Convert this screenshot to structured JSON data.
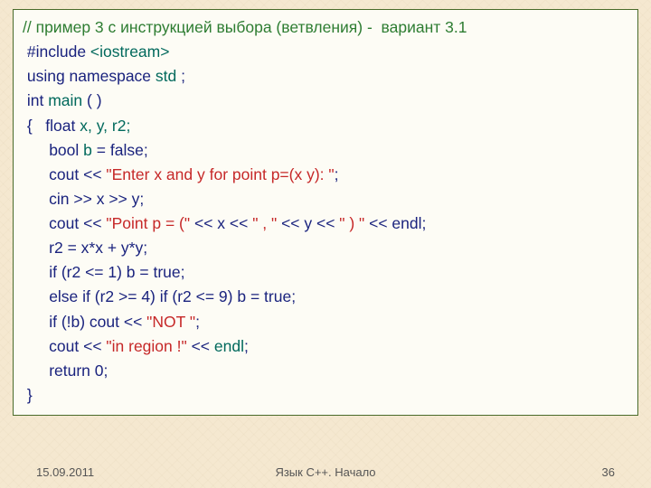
{
  "code": {
    "l1a": "// пример 3 с инструкцией выбора (ветвления) -  вариант 3.1",
    "l2a": " #include ",
    "l2b": "<iostream>",
    "l3a": " using namespace ",
    "l3b": "std ",
    "l3c": ";",
    "l4a": " int ",
    "l4b": "main ",
    "l4c": "( )",
    "l5a": " {   ",
    "l5b": "float ",
    "l5c": "x, y, r2;",
    "l6a": "      ",
    "l6b": "bool ",
    "l6c": "b ",
    "l6d": "= ",
    "l6e": "false",
    "l6f": ";",
    "l7a": "      cout << ",
    "l7b": "\"Enter x and y for point p=(x y): \"",
    "l7c": ";",
    "l8a": "      cin >> x >> y;",
    "l9a": "      cout << ",
    "l9b": "\"Point p = (\" ",
    "l9c": "<< x << ",
    "l9d": "\" , \" ",
    "l9e": "<< y << ",
    "l9f": "\" ) \" ",
    "l9g": "<< endl;",
    "l10a": "      r2 = x*x + y*y;",
    "l11a": "      ",
    "l11b": "if ",
    "l11c": "(r2 <= 1) b = ",
    "l11d": "true",
    "l11e": ";",
    "l12a": "      ",
    "l12b": "else if ",
    "l12c": "(r2 >= 4) ",
    "l12d": "if ",
    "l12e": "(r2 <= 9) b = ",
    "l12f": "true",
    "l12g": ";",
    "l13a": "      ",
    "l13b": "if ",
    "l13c": "(!b) cout << ",
    "l13d": "\"NOT \"",
    "l13e": ";",
    "l14a": "      cout << ",
    "l14b": "\"in region !\" ",
    "l14c": "<< ",
    "l14d": "endl",
    "l14e": ";",
    "l15a": "      ",
    "l15b": "return ",
    "l15c": "0;",
    "l16a": " }"
  },
  "footer": {
    "date": "15.09.2011",
    "title": "Язык С++. Начало",
    "page": "36"
  }
}
